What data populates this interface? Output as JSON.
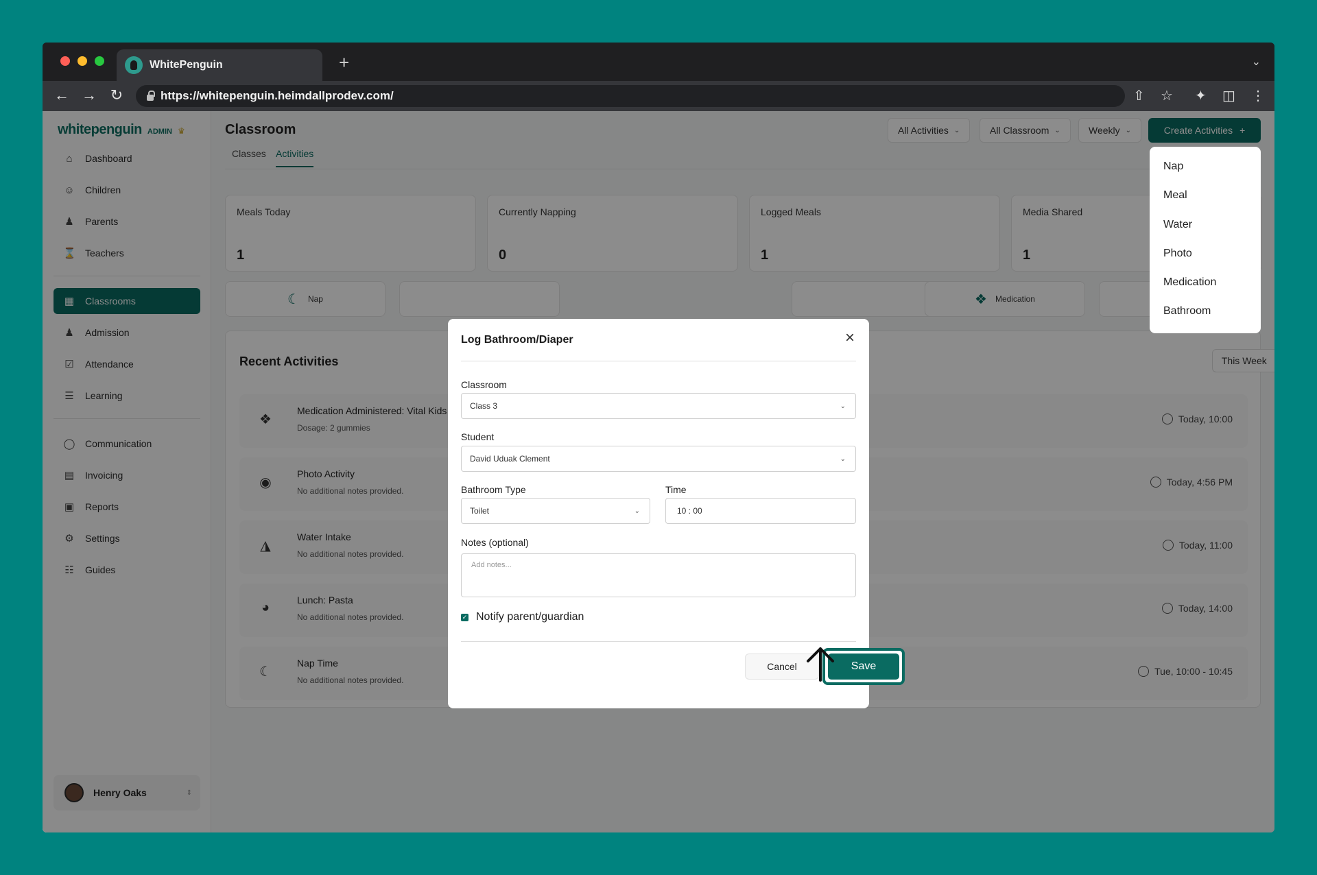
{
  "browser": {
    "tab_title": "WhitePenguin",
    "url": "https://whitepenguin.heimdallprodev.com/"
  },
  "sidebar": {
    "logo": "whitepenguin",
    "logo_badge": "ADMIN",
    "items": [
      {
        "label": "Dashboard",
        "icon": "home-icon"
      },
      {
        "label": "Children",
        "icon": "child-icon"
      },
      {
        "label": "Parents",
        "icon": "users-icon"
      },
      {
        "label": "Teachers",
        "icon": "teacher-icon"
      },
      {
        "label": "Classrooms",
        "icon": "grid-icon",
        "active": true
      },
      {
        "label": "Admission",
        "icon": "admission-icon"
      },
      {
        "label": "Attendance",
        "icon": "attendance-icon"
      },
      {
        "label": "Learning",
        "icon": "learning-icon"
      },
      {
        "label": "Communication",
        "icon": "chat-icon"
      },
      {
        "label": "Invoicing",
        "icon": "invoice-icon"
      },
      {
        "label": "Reports",
        "icon": "reports-icon"
      },
      {
        "label": "Settings",
        "icon": "gear-icon"
      },
      {
        "label": "Guides",
        "icon": "book-icon"
      }
    ],
    "user_name": "Henry Oaks"
  },
  "header": {
    "title": "Classroom",
    "filters": [
      "All Activities",
      "All Classroom",
      "Weekly"
    ],
    "create_label": "Create Activities",
    "tabs": [
      "Classes",
      "Activities"
    ]
  },
  "create_menu": [
    "Nap",
    "Meal",
    "Water",
    "Photo",
    "Medication",
    "Bathroom"
  ],
  "stats": [
    {
      "label": "Meals Today",
      "value": "1"
    },
    {
      "label": "Currently Napping",
      "value": "0"
    },
    {
      "label": "Logged Meals",
      "value": "1"
    },
    {
      "label": "Media Shared",
      "value": "1"
    }
  ],
  "quick_actions": [
    "Nap",
    "Medication"
  ],
  "recent": {
    "title": "Recent Activities",
    "range_label": "This Week",
    "rows": [
      {
        "title": "Medication Administered: Vital Kids",
        "sub": "Dosage: 2 gummies",
        "time": "Today, 10:00",
        "icon": "pill-icon"
      },
      {
        "title": "Photo Activity",
        "sub": "No additional notes provided.",
        "time": "Today, 4:56 PM",
        "icon": "camera-icon"
      },
      {
        "title": "Water Intake",
        "sub": "No additional notes provided.",
        "time": "Today, 11:00",
        "icon": "bottle-icon"
      },
      {
        "title": "Lunch: Pasta",
        "sub": "No additional notes provided.",
        "time": "Today, 14:00",
        "icon": "bowl-icon"
      },
      {
        "title": "Nap Time",
        "sub": "No additional notes provided.",
        "time": "Tue, 10:00 - 10:45",
        "icon": "moon-icon"
      }
    ]
  },
  "modal": {
    "title": "Log Bathroom/Diaper",
    "classroom_label": "Classroom",
    "classroom_value": "Class 3",
    "student_label": "Student",
    "student_value": "David Uduak Clement",
    "type_label": "Bathroom Type",
    "type_value": "Toilet",
    "time_label": "Time",
    "time_value": "10 : 00",
    "notes_label": "Notes (optional)",
    "notes_placeholder": "Add notes...",
    "notify_label": "Notify parent/guardian",
    "notify_checked": true,
    "cancel_label": "Cancel",
    "save_label": "Save"
  },
  "colors": {
    "brand": "#0a6b61",
    "background": "#00837f"
  }
}
